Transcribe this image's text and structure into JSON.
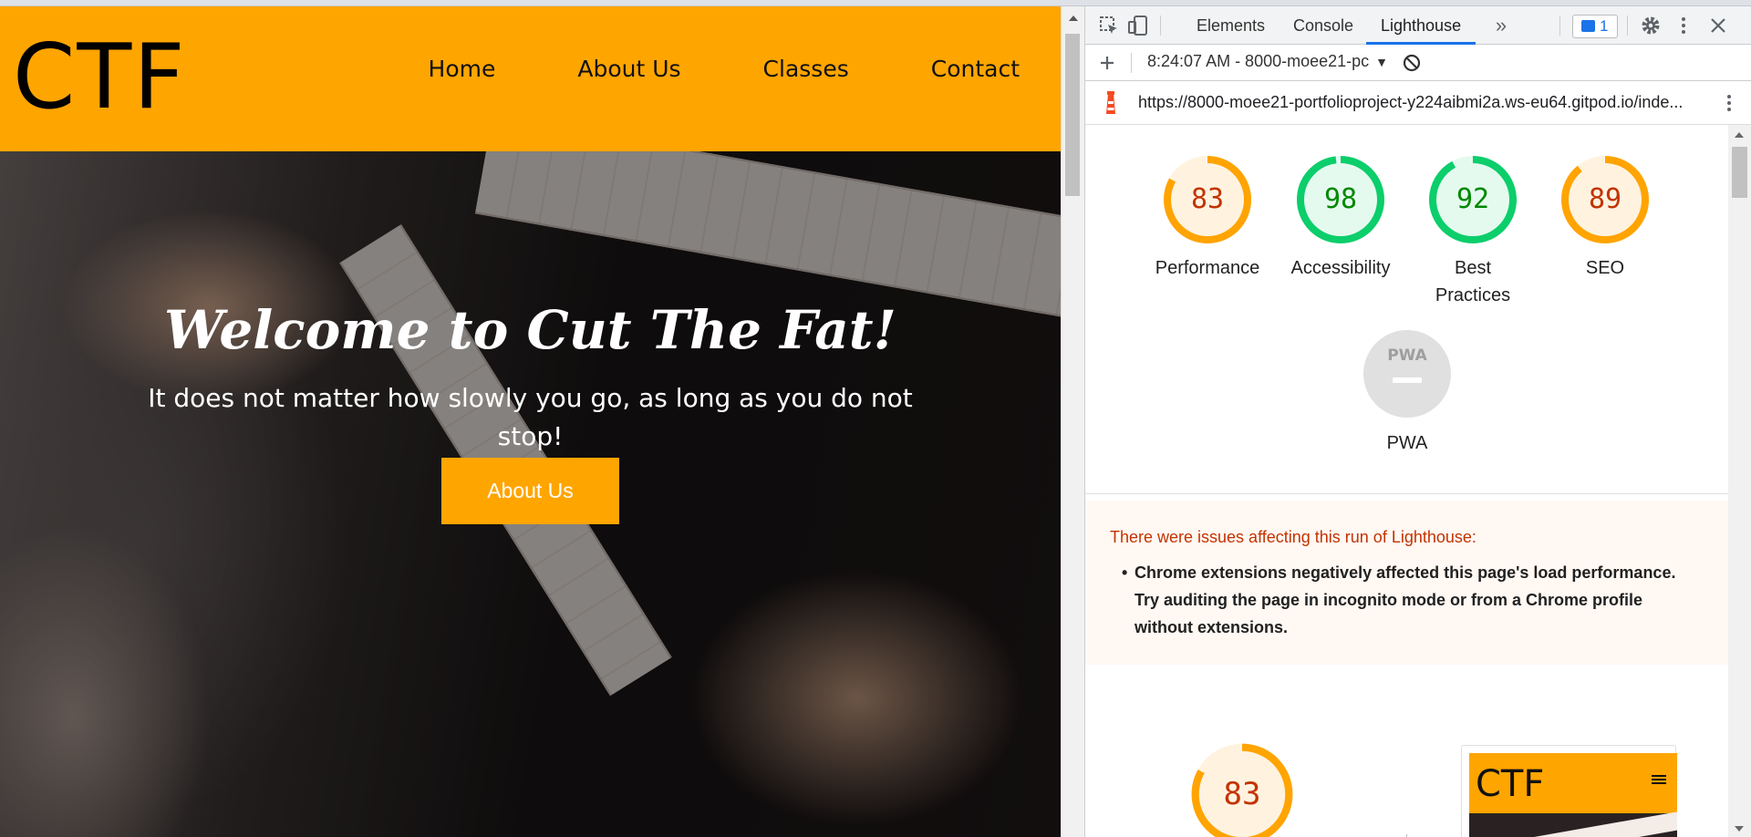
{
  "site": {
    "logo": "CTF",
    "nav": [
      "Home",
      "About Us",
      "Classes",
      "Contact"
    ],
    "hero": {
      "title": "Welcome to Cut The Fat!",
      "text": "It does not matter how slowly you go, as long as you do not stop!",
      "button": "About Us"
    }
  },
  "devtools": {
    "tabs": [
      "Elements",
      "Console",
      "Lighthouse"
    ],
    "active_tab": "Lighthouse",
    "more_tabs_icon": "»",
    "message_count": "1",
    "report_selector": "8:24:07 AM - 8000-moee21-pc",
    "url": "https://8000-moee21-portfolioproject-y224aibmi2a.ws-eu64.gitpod.io/inde...",
    "scores": [
      {
        "label": "Performance",
        "value": 83,
        "status": "average"
      },
      {
        "label": "Accessibility",
        "value": 98,
        "status": "pass"
      },
      {
        "label": "Best Practices",
        "value": 92,
        "status": "pass"
      },
      {
        "label": "SEO",
        "value": 89,
        "status": "average"
      }
    ],
    "pwa": {
      "badge": "PWA",
      "label": "PWA"
    },
    "warning": {
      "title": "There were issues affecting this run of Lighthouse:",
      "items": [
        "Chrome extensions negatively affected this page's load performance. Try auditing the page in incognito mode or from a Chrome profile without extensions."
      ]
    },
    "perf_gauge": {
      "value": 83
    },
    "thumbnail_logo": "CTF",
    "colors": {
      "average": "#ffa400",
      "average_text": "#c33300",
      "average_fill": "#fff3e0",
      "pass": "#0cce6b",
      "pass_text": "#008800",
      "pass_fill": "#e5faef",
      "site_brand": "#ffa500"
    }
  }
}
